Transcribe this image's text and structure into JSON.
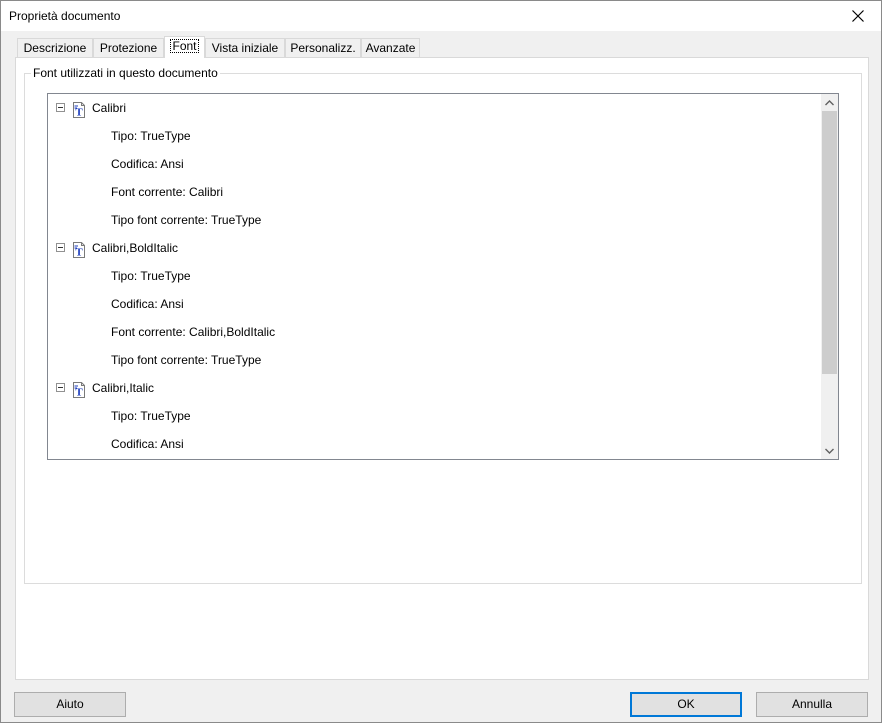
{
  "window": {
    "title": "Proprietà documento"
  },
  "tabs": [
    {
      "label": "Descrizione",
      "active": false
    },
    {
      "label": "Protezione",
      "active": false
    },
    {
      "label": "Font",
      "active": true
    },
    {
      "label": "Vista iniziale",
      "active": false
    },
    {
      "label": "Personalizz.",
      "active": false
    },
    {
      "label": "Avanzate",
      "active": false
    }
  ],
  "group": {
    "label": "Font utilizzati in questo documento"
  },
  "fonts": [
    {
      "name": "Calibri",
      "details": [
        "Tipo: TrueType",
        "Codifica: Ansi",
        "Font corrente: Calibri",
        "Tipo font corrente: TrueType"
      ]
    },
    {
      "name": "Calibri,BoldItalic",
      "details": [
        "Tipo: TrueType",
        "Codifica: Ansi",
        "Font corrente: Calibri,BoldItalic",
        "Tipo font corrente: TrueType"
      ]
    },
    {
      "name": "Calibri,Italic",
      "details": [
        "Tipo: TrueType",
        "Codifica: Ansi"
      ]
    }
  ],
  "buttons": {
    "help": "Aiuto",
    "ok": "OK",
    "cancel": "Annulla"
  },
  "colors": {
    "accent": "#0078d7",
    "icon_blue": "#1f3fbf"
  },
  "icons": {
    "close": "close-icon",
    "font": "truetype-font-icon",
    "expander": "collapse-icon",
    "up": "chevron-up-icon",
    "down": "chevron-down-icon"
  }
}
